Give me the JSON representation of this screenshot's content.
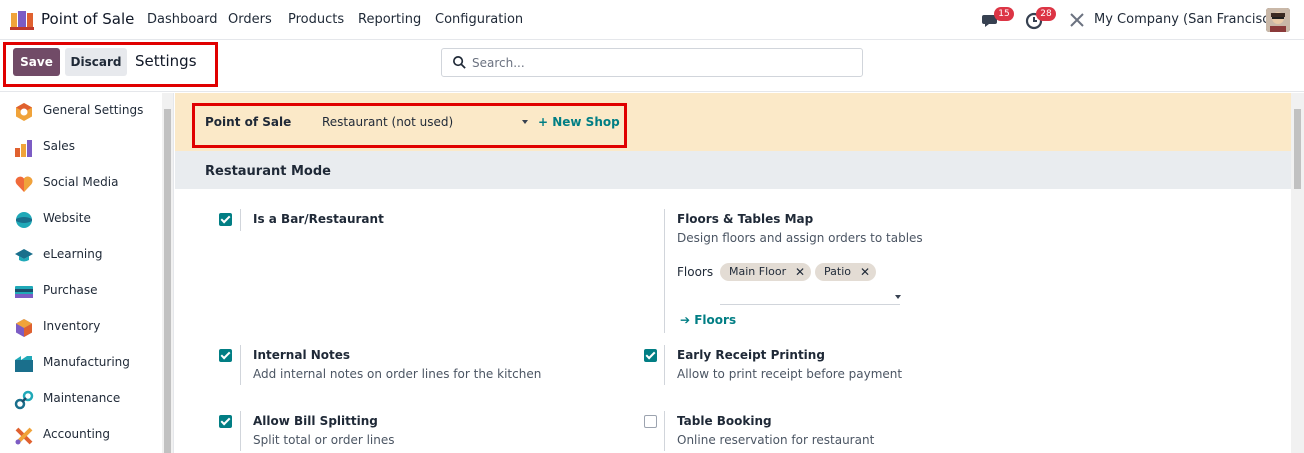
{
  "navbar": {
    "app_name": "Point of Sale",
    "menu": [
      "Dashboard",
      "Orders",
      "Products",
      "Reporting",
      "Configuration"
    ],
    "messages_count": "15",
    "activities_count": "28",
    "company": "My Company (San Francisco)"
  },
  "control": {
    "save_label": "Save",
    "discard_label": "Discard",
    "title": "Settings",
    "search_placeholder": "Search..."
  },
  "sidebar": {
    "items": [
      {
        "label": "General Settings",
        "icon": "general-settings-icon"
      },
      {
        "label": "Sales",
        "icon": "sales-icon"
      },
      {
        "label": "Social Media",
        "icon": "social-media-icon"
      },
      {
        "label": "Website",
        "icon": "website-icon"
      },
      {
        "label": "eLearning",
        "icon": "elearning-icon"
      },
      {
        "label": "Purchase",
        "icon": "purchase-icon"
      },
      {
        "label": "Inventory",
        "icon": "inventory-icon"
      },
      {
        "label": "Manufacturing",
        "icon": "manufacturing-icon"
      },
      {
        "label": "Maintenance",
        "icon": "maintenance-icon"
      },
      {
        "label": "Accounting",
        "icon": "accounting-icon"
      }
    ]
  },
  "shop": {
    "label": "Point of Sale",
    "selected": "Restaurant (not used)",
    "new_shop": "+ New Shop"
  },
  "section": {
    "title": "Restaurant Mode"
  },
  "options": {
    "bar_restaurant": {
      "title": "Is a Bar/Restaurant",
      "checked": true
    },
    "floors_map": {
      "title": "Floors & Tables Map",
      "desc": "Design floors and assign orders to tables",
      "floors_label": "Floors",
      "tags": [
        "Main Floor",
        "Patio"
      ],
      "link": "Floors"
    },
    "internal_notes": {
      "title": "Internal Notes",
      "desc": "Add internal notes on order lines for the kitchen",
      "checked": true
    },
    "early_receipt": {
      "title": "Early Receipt Printing",
      "desc": "Allow to print receipt before payment",
      "checked": true
    },
    "bill_splitting": {
      "title": "Allow Bill Splitting",
      "desc": "Split total or order lines",
      "checked": true
    },
    "table_booking": {
      "title": "Table Booking",
      "desc": "Online reservation for restaurant",
      "checked": false
    }
  },
  "colors": {
    "primary": "#714b67",
    "accent": "#017e84",
    "highlight": "#e00000",
    "shop_bar": "#fbe9c8"
  }
}
